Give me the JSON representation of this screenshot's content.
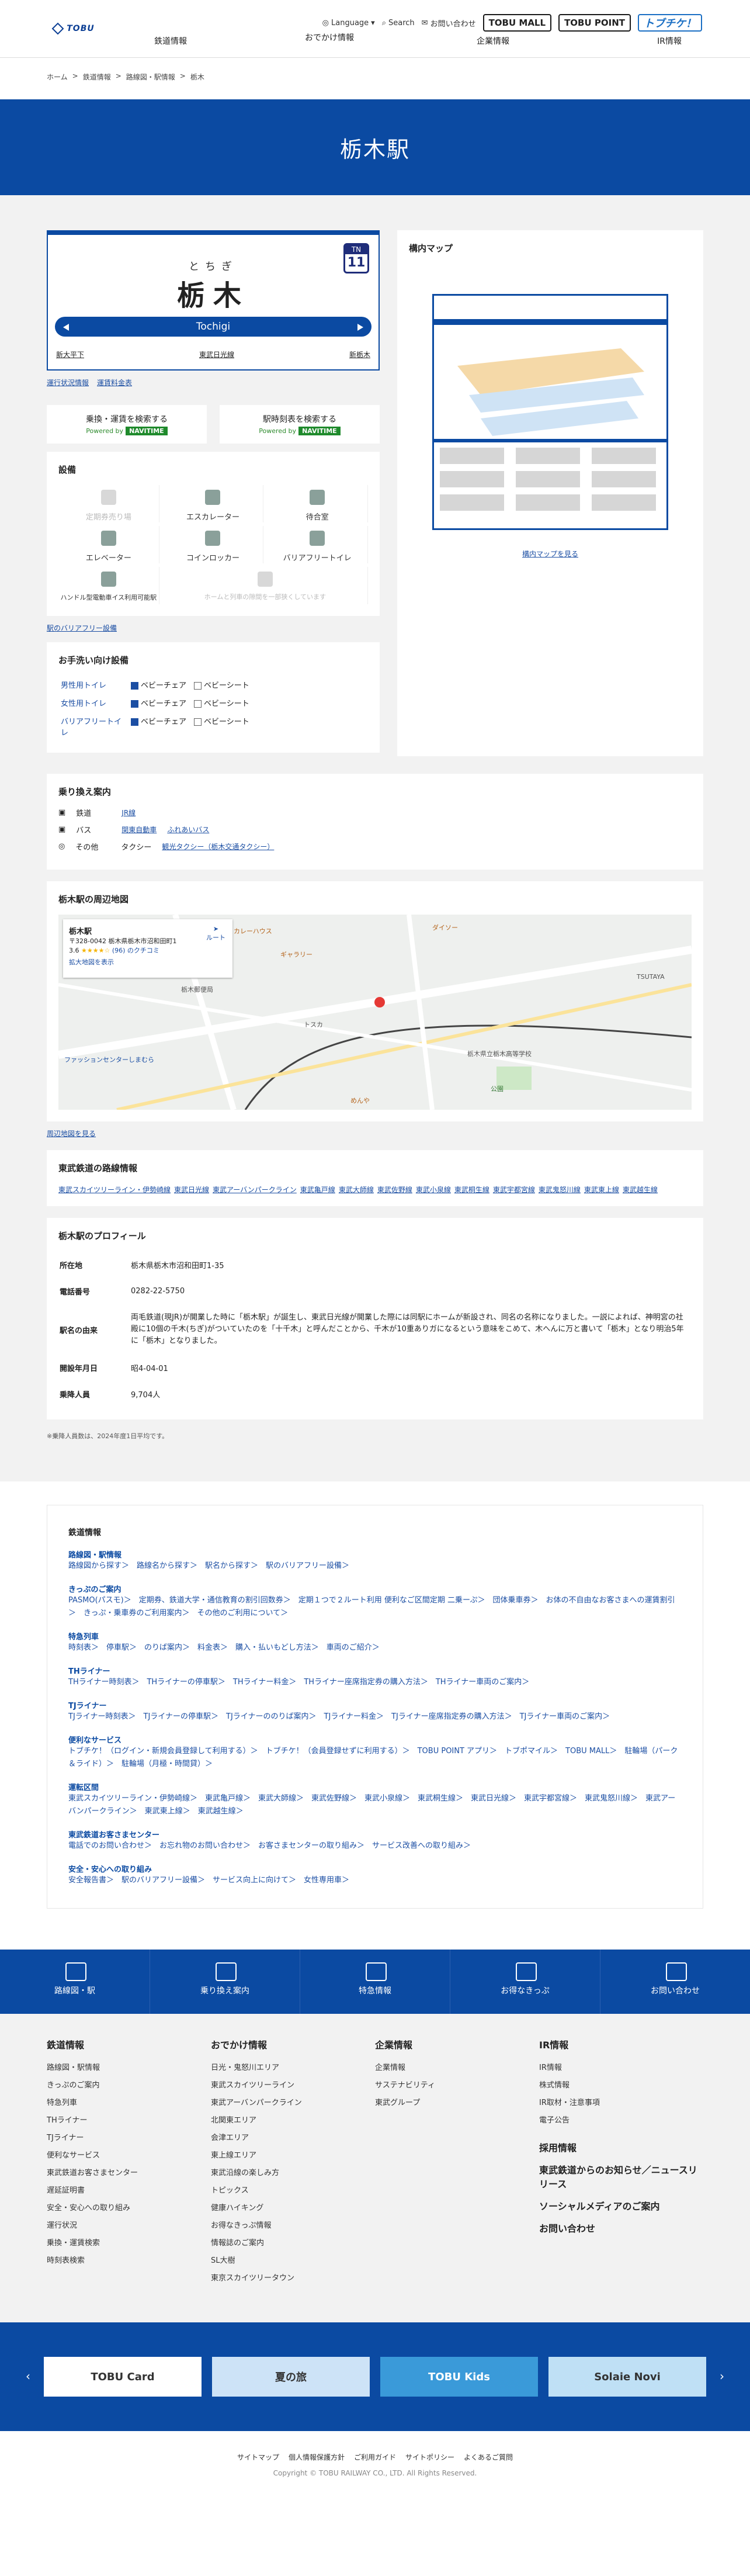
{
  "header": {
    "logo_text": "TOBU",
    "nav": [
      "鉄道情報",
      "おでかけ情報",
      "企業情報",
      "IR情報"
    ],
    "util": {
      "language": "Language",
      "search": "Search",
      "contact": "お問い合わせ"
    },
    "brands": [
      "TOBU MALL",
      "TOBU POINT",
      "トブチケ！"
    ]
  },
  "breadcrumb": [
    "ホーム",
    "鉄道情報",
    "路線図・駅情報",
    "栃木"
  ],
  "page_title": "栃木駅",
  "station": {
    "kana": "とちぎ",
    "kanji": "栃木",
    "roman": "Tochigi",
    "number_prefix": "TN",
    "number": "11",
    "prev": "新大平下",
    "mid": "東武日光線",
    "next": "新栃木",
    "link_timetable": "運行状況情報",
    "link_price": "運賃料金表"
  },
  "search": [
    {
      "title": "乗換・運賃を検索する",
      "powered": "Powered by",
      "brand": "NAVITIME"
    },
    {
      "title": "駅時刻表を検索する",
      "powered": "Powered by",
      "brand": "NAVITIME"
    }
  ],
  "facilities": {
    "title": "設備",
    "items": [
      {
        "label": "定期券売り場",
        "off": true
      },
      {
        "label": "エスカレーター",
        "off": false
      },
      {
        "label": "待合室",
        "off": false
      },
      {
        "label": "エレベーター",
        "off": false
      },
      {
        "label": "コインロッカー",
        "off": false
      },
      {
        "label": "バリアフリートイレ",
        "off": false
      },
      {
        "label": "ハンドル型電動車イス利用可能駅",
        "off": false
      },
      {
        "label": "ホームと列車の隙間を一部狭くしています",
        "off": true
      }
    ],
    "link": "駅のバリアフリー設備"
  },
  "toilets": {
    "title": "お手洗い向け設備",
    "rows": [
      {
        "name": "男性用トイレ",
        "a": "ベビーチェア",
        "b": "ベビーシート",
        "a_on": true,
        "b_on": false
      },
      {
        "name": "女性用トイレ",
        "a": "ベビーチェア",
        "b": "ベビーシート",
        "a_on": true,
        "b_on": false
      },
      {
        "name": "バリアフリートイレ",
        "a": "ベビーチェア",
        "b": "ベビーシート",
        "a_on": true,
        "b_on": false
      }
    ]
  },
  "premap": {
    "title": "構内マップ",
    "link": "構内マップを見る"
  },
  "transfer": {
    "title": "乗り換え案内",
    "rows": [
      {
        "type": "鉄道",
        "links": [
          "JR線"
        ]
      },
      {
        "type": "バス",
        "links": [
          "関東自動車",
          "ふれあいバス"
        ]
      },
      {
        "type": "その他",
        "links": [
          "タクシー",
          "観光タクシー（栃木交通タクシー）"
        ]
      }
    ]
  },
  "nearby": {
    "title": "栃木駅の周辺地図",
    "place": "栃木駅",
    "address": "〒328-0042 栃木県栃木市沼和田町1",
    "rating": "3.6",
    "reviews": "(96) のクチコミ",
    "route": "ルート",
    "enlarge": "拡大地図を表示",
    "link": "周辺地図を見る",
    "labels": [
      "カレーハウス",
      "ダイソー",
      "ギャラリー",
      "栃木郵便局",
      "栃木県立栃木高等学校",
      "ファッションセンターしまむら",
      "トスカ",
      "めんや",
      "TSUTAYA",
      "公園"
    ]
  },
  "lines": {
    "title": "東武鉄道の路線情報",
    "items": [
      "東武スカイツリーライン・伊勢崎線",
      "東武日光線",
      "東武アーバンパークライン",
      "東武亀戸線",
      "東武大師線",
      "東武佐野線",
      "東武小泉線",
      "東武桐生線",
      "東武宇都宮線",
      "東武鬼怒川線",
      "東武東上線",
      "東武越生線"
    ]
  },
  "profile": {
    "title": "栃木駅のプロフィール",
    "rows": [
      {
        "k": "所在地",
        "v": "栃木県栃木市沼和田町1-35"
      },
      {
        "k": "電話番号",
        "v": "0282-22-5750"
      },
      {
        "k": "駅名の由来",
        "v": "両毛鉄道(現JR)が開業した時に「栃木駅」が誕生し、東武日光線が開業した際には同駅にホームが新設され、同名の名称になりました。一説によれば、神明宮の社殿に10個の千木(ちぎ)がついていたのを「十千木」と呼んだことから、千木が10重ありガになるという意味をこめて、木へんに万と書いて「栃木」となり明治5年に「栃木」となりました。"
      },
      {
        "k": "開設年月日",
        "v": "昭4-04-01"
      },
      {
        "k": "乗降人員",
        "v": "9,704人"
      }
    ],
    "note": "※乗降人員数は、2024年度1日平均です。"
  },
  "menu": {
    "title": "鉄道情報",
    "sections": [
      {
        "title": "路線図・駅情報",
        "links": "路線図から探す＞　路線名から探す＞　駅名から探す＞　駅のバリアフリー設備＞"
      },
      {
        "title": "きっぷのご案内",
        "links": "PASMO(パスモ)＞　定期券、鉄道大学・通信教育の割引回数券＞　定期１つで２ルート利用 便利なご区間定期 二乗ーぷ＞　団体乗車券＞　お体の不自由なお客さまへの運賃割引＞　きっぷ・乗車券のご利用案内＞　その他のご利用について＞"
      },
      {
        "title": "特急列車",
        "links": "時刻表＞　停車駅＞　のりば案内＞　料金表＞　購入・払いもどし方法＞　車両のご紹介＞"
      },
      {
        "title": "THライナー",
        "links": "THライナー時刻表＞　THライナーの停車駅＞　THライナー料金＞　THライナー座席指定券の購入方法＞　THライナー車両のご案内＞"
      },
      {
        "title": "TJライナー",
        "links": "TJライナー時刻表＞　TJライナーの停車駅＞　TJライナーののりば案内＞　TJライナー料金＞　TJライナー座席指定券の購入方法＞　TJライナー車両のご案内＞"
      },
      {
        "title": "便利なサービス",
        "links": "トブチケ！（ログイン・新規会員登録して利用する）＞　トブチケ！（会員登録せずに利用する）＞　TOBU POINT アプリ＞　トブポマイル＞　TOBU MALL＞　駐輪場（パーク＆ライド）＞　駐輪場（月極・時間貸）＞"
      },
      {
        "title": "運転区間",
        "links": "東武スカイツリーライン・伊勢崎線＞　東武亀戸線＞　東武大師線＞　東武佐野線＞　東武小泉線＞　東武桐生線＞　東武日光線＞　東武宇都宮線＞　東武鬼怒川線＞　東武アーバンパークライン＞　東武東上線＞　東武越生線＞"
      },
      {
        "title": "東武鉄道お客さまセンター",
        "links": "電話でのお問い合わせ＞　お忘れ物のお問い合わせ＞　お客さまセンターの取り組み＞　サービス改善への取り組み＞"
      },
      {
        "title": "安全・安心への取り組み",
        "links": "安全報告書＞　駅のバリアフリー設備＞　サービス向上に向けて＞　女性専用車＞"
      }
    ]
  },
  "iconbar": [
    "路線図・駅",
    "乗り換え案内",
    "特急情報",
    "お得なきっぷ",
    "お問い合わせ"
  ],
  "sitemap": [
    {
      "title": "鉄道情報",
      "items": [
        "路線図・駅情報",
        "きっぷのご案内",
        "特急列車",
        "THライナー",
        "TJライナー",
        "便利なサービス",
        "東武鉄道お客さまセンター",
        "遅延証明書",
        "安全・安心への取り組み",
        "運行状況",
        "乗換・運賃検索",
        "時刻表検索"
      ]
    },
    {
      "title": "おでかけ情報",
      "items": [
        "日光・鬼怒川エリア",
        "東武スカイツリーライン",
        "東武アーバンパークライン",
        "北関東エリア",
        "会津エリア",
        "東上線エリア",
        "東武沿線の楽しみ方",
        "トピックス",
        "健康ハイキング",
        "お得なきっぷ情報",
        "情報誌のご案内",
        "SL大樹",
        "東京スカイツリータウン"
      ]
    },
    {
      "title": "企業情報",
      "items": [
        "企業情報",
        "サステナビリティ",
        "東武グループ"
      ]
    },
    {
      "title": "IR情報",
      "items": [
        "IR情報",
        "株式情報",
        "IR取材・注意事項",
        "電子公告"
      ]
    }
  ],
  "sitemap_extra": [
    "採用情報",
    "東武鉄道からのお知らせ／ニュースリリース",
    "ソーシャルメディアのご案内",
    "お問い合わせ"
  ],
  "banners": [
    "TOBU Card",
    "夏の旅",
    "TOBU Kids",
    "Solaie Novi"
  ],
  "footer": {
    "links": [
      "サイトマップ",
      "個人情報保護方針",
      "ご利用ガイド",
      "サイトポリシー",
      "よくあるご質問"
    ],
    "copyright": "Copyright © TOBU RAILWAY CO., LTD. All Rights Reserved."
  }
}
